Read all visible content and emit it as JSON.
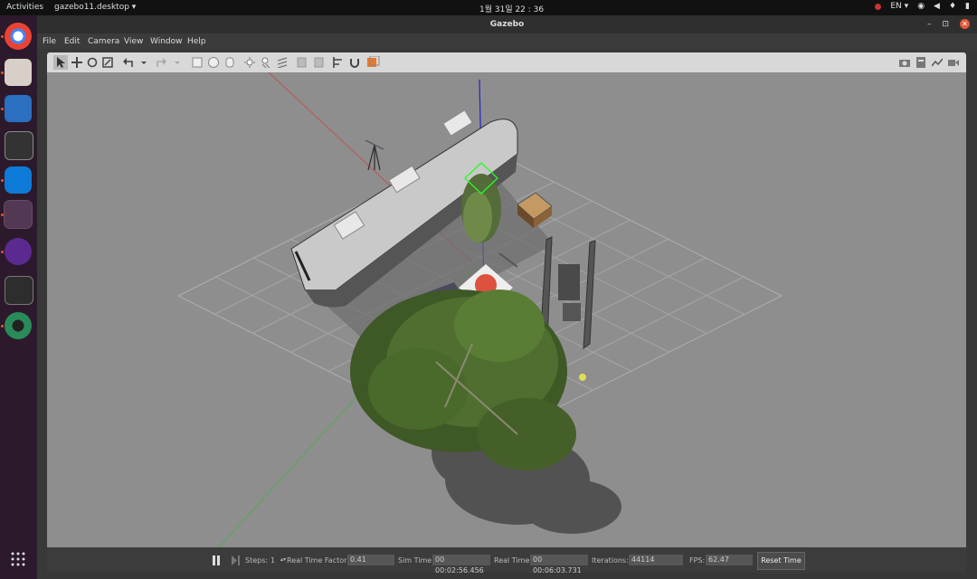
{
  "topbar": {
    "activities": "Activities",
    "app_menu": "gazebo11.desktop ▾",
    "clock": "1월 31일 22 : 36",
    "lang": "EN ▾"
  },
  "dock": {
    "items": [
      "chrome-icon",
      "files-icon",
      "writer-icon",
      "sysmon-icon",
      "teamviewer-icon",
      "gazebo-icon",
      "qgroundcontrol-icon",
      "terminal-icon",
      "camera-icon"
    ]
  },
  "window": {
    "title": "Gazebo",
    "min": "–",
    "restore": "⊡",
    "close": "✕"
  },
  "menu": [
    "File",
    "Edit",
    "Camera",
    "View",
    "Window",
    "Help"
  ],
  "toolbar_icons": [
    "select-arrow-icon",
    "translate-icon",
    "rotate-icon",
    "scale-icon",
    "undo-icon",
    "undo-dropdown-icon",
    "redo-icon",
    "redo-dropdown-icon",
    "box-icon",
    "sphere-icon",
    "cylinder-icon",
    "point-light-icon",
    "spot-light-icon",
    "directional-light-icon",
    "copy-icon",
    "paste-icon",
    "align-icon",
    "snap-icon",
    "view-angle-icon"
  ],
  "toolbar_right_icons": [
    "screenshot-icon",
    "log-icon",
    "plot-icon",
    "video-icon"
  ],
  "bottom": {
    "steps_label": "Steps:",
    "steps_value": "1",
    "rtf_label": "Real Time Factor:",
    "rtf_value": "0.41",
    "sim_label": "Sim Time:",
    "sim_value": "00 00:02:56.456",
    "real_label": "Real Time:",
    "real_value": "00 00:06:03.731",
    "iter_label": "Iterations:",
    "iter_value": "44114",
    "fps_label": "FPS:",
    "fps_value": "62.47",
    "reset_label": "Reset Time"
  },
  "colors": {
    "viewport_bg": "#8e8e8e",
    "accent": "#e95420"
  }
}
